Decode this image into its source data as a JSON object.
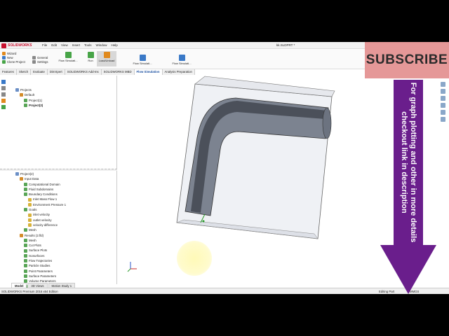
{
  "app": {
    "brand": "SOLIDWORKS",
    "doc_title": "kk.SLDPRT *",
    "edition": "SOLIDWORKS Premium 2016 x64 Edition"
  },
  "menu": [
    "File",
    "Edit",
    "View",
    "Insert",
    "Tools",
    "Window",
    "Help"
  ],
  "ribbon": {
    "left_items": [
      "Wizard",
      "New",
      "Clone Project"
    ],
    "general_items": [
      "General",
      "Settings"
    ],
    "flow_sim_1": "Flow Simulati...",
    "run": "Run",
    "load_unload": "Load/Unload",
    "flow_sim_2": "Flow Simulati...",
    "flow_sim_3": "Flow Simulati..."
  },
  "command_tabs": [
    "Features",
    "Sketch",
    "Evaluate",
    "DimXpert",
    "SOLIDWORKS Add-Ins",
    "SOLIDWORKS MBD",
    "Flow Simulation",
    "Analysis Preparation"
  ],
  "active_tab": "Flow Simulation",
  "upper_tree": [
    {
      "label": "Projects",
      "level": 0,
      "bold": false
    },
    {
      "label": "Default",
      "level": 1,
      "bold": false
    },
    {
      "label": "Project(1)",
      "level": 2,
      "bold": false
    },
    {
      "label": "Project(2)",
      "level": 2,
      "bold": true
    }
  ],
  "lower_tree": [
    {
      "label": "Project(2)",
      "level": 0
    },
    {
      "label": "Input Data",
      "level": 1
    },
    {
      "label": "Computational Domain",
      "level": 2
    },
    {
      "label": "Fluid Subdomains",
      "level": 2
    },
    {
      "label": "Boundary Conditions",
      "level": 2
    },
    {
      "label": "Inlet Mass Flow 1",
      "level": 3
    },
    {
      "label": "Environment Pressure 1",
      "level": 3
    },
    {
      "label": "Goals",
      "level": 2
    },
    {
      "label": "inlet velocity",
      "level": 3
    },
    {
      "label": "outlet velocity",
      "level": 3
    },
    {
      "label": "velocity difference",
      "level": 3
    },
    {
      "label": "Mesh",
      "level": 2
    },
    {
      "label": "Results (2.fld)",
      "level": 1
    },
    {
      "label": "Mesh",
      "level": 2
    },
    {
      "label": "Cut Plots",
      "level": 2
    },
    {
      "label": "Surface Plots",
      "level": 2
    },
    {
      "label": "Isosurfaces",
      "level": 2
    },
    {
      "label": "Flow Trajectories",
      "level": 2
    },
    {
      "label": "Particle Studies",
      "level": 2
    },
    {
      "label": "Point Parameters",
      "level": 2
    },
    {
      "label": "Surface Parameters",
      "level": 2
    },
    {
      "label": "Volume Parameters",
      "level": 2
    },
    {
      "label": "XY Plots",
      "level": 2
    },
    {
      "label": "Goal Plots",
      "level": 2
    },
    {
      "label": "Report",
      "level": 2
    },
    {
      "label": "Animations",
      "level": 2
    },
    {
      "label": "Export Results",
      "level": 2
    }
  ],
  "bottom_tabs": [
    "Model",
    "3D Views",
    "Motion Study 1"
  ],
  "status": {
    "editing": "Editing Part",
    "units": "MMGS"
  },
  "overlay": {
    "subscribe": "SUBSCRIBE",
    "arrow_text": "For graph plotting and other in more details checkout link in description",
    "subscribe_color": "#e59898",
    "arrow_color": "#6a1e8c"
  }
}
